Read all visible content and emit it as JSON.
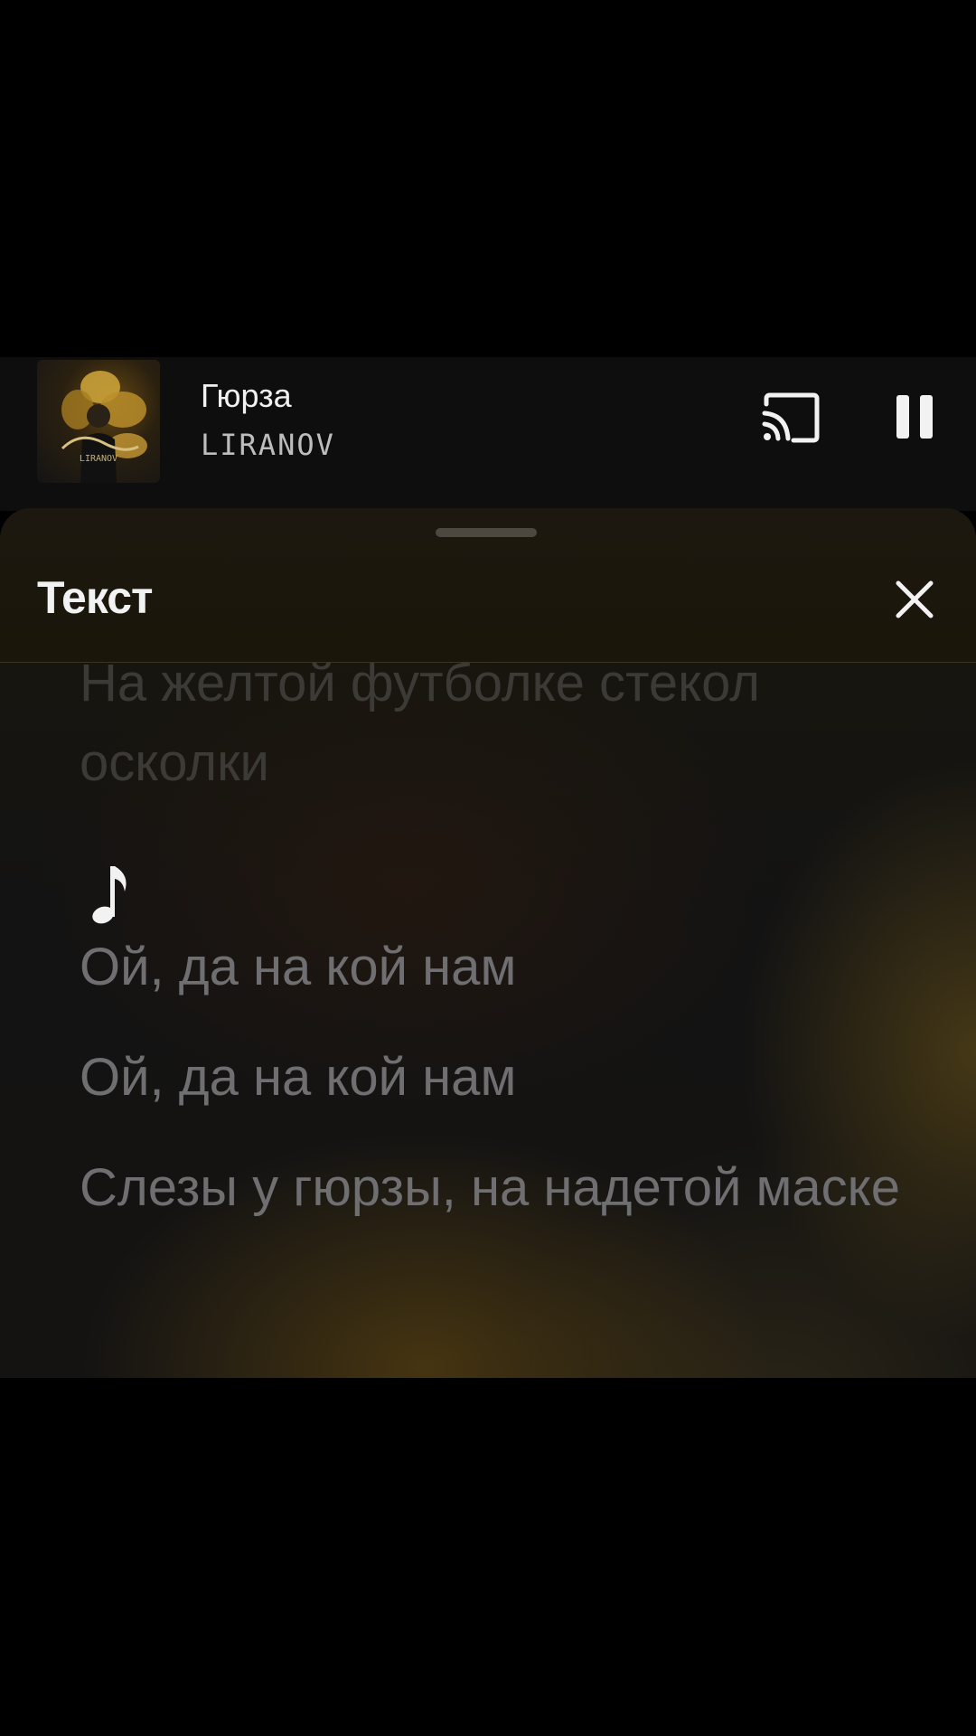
{
  "now_playing": {
    "title": "Гюрза",
    "artist": "LIRANOV",
    "cover_art": {
      "title_script": "Гюрза",
      "artist": "LIRANOV"
    },
    "cast_icon": "cast-icon",
    "pause_icon": "pause-icon"
  },
  "lyrics_sheet": {
    "title": "Текст",
    "close_icon": "close-icon",
    "lines": [
      "На желтой футболке стекол осколки",
      "♪",
      "Ой, да на кой нам",
      "Ой, да на кой нам",
      "Слезы у гюрзы, на надетой маске"
    ]
  },
  "colors": {
    "background": "#000000",
    "accent_gold": "#6e5618",
    "lyric_text": "#6f6f72"
  }
}
